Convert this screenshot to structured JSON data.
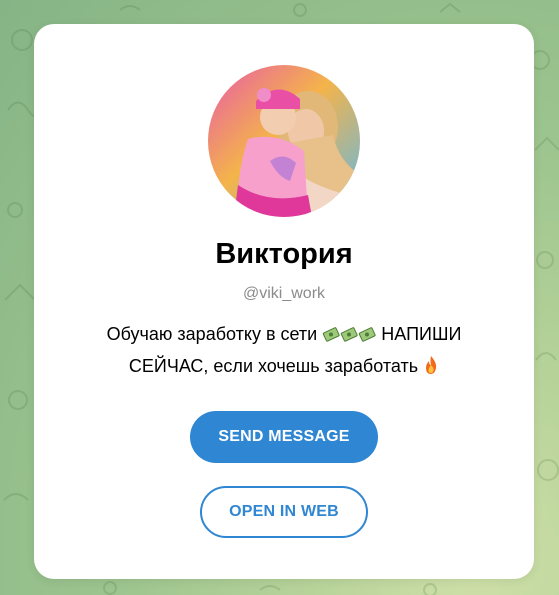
{
  "profile": {
    "name": "Виктория",
    "username": "@viki_work",
    "bio_part1": "Обучаю заработку в сети",
    "bio_part2": "НАПИШИ СЕЙЧАС, если хочешь заработать",
    "bio_icons": [
      "money-with-wings-icon",
      "money-with-wings-icon",
      "money-with-wings-icon",
      "fire-icon"
    ]
  },
  "actions": {
    "send_message": "SEND MESSAGE",
    "open_in_web": "OPEN IN WEB"
  },
  "colors": {
    "accent": "#2f86d2",
    "background_green": "#9cc48e",
    "card": "#ffffff"
  }
}
